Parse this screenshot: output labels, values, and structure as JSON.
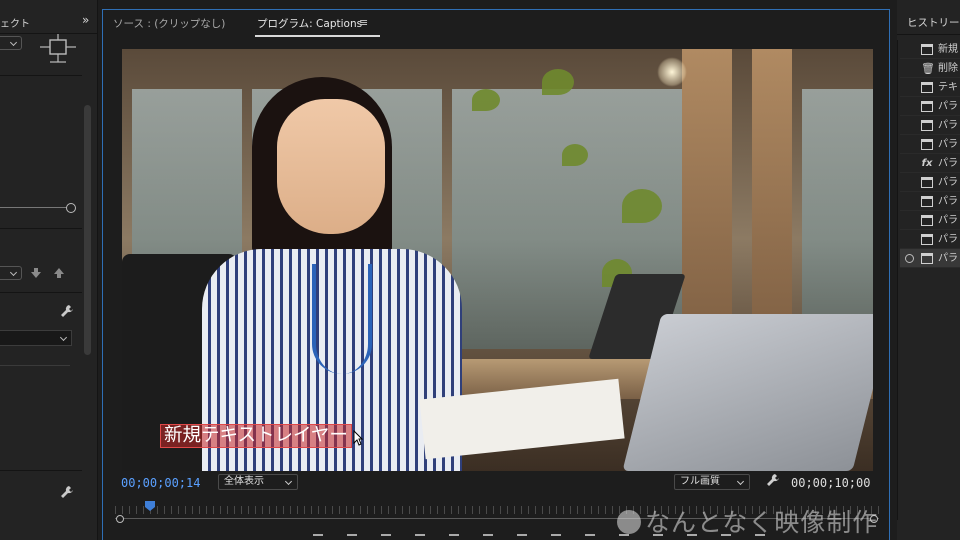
{
  "left_panel": {
    "tab_title": "ェクト",
    "expand_glyph": "»"
  },
  "monitor": {
    "source_tab": "ソース : (クリップなし)",
    "program_tab": "プログラム: Captions",
    "menu_glyph": "≡",
    "caption": "新規テキストレイヤー",
    "timecode_current": "00;00;00;14",
    "zoom": "全体表示",
    "quality": "フル画質",
    "timecode_duration": "00;00;10;00",
    "accent_color": "#2f6fb5",
    "timecode_color": "#5aa0ff",
    "caption_box_color": "#e04848"
  },
  "history": {
    "title": "ヒストリー",
    "items": [
      {
        "icon": "clip-icon",
        "label": "新規"
      },
      {
        "icon": "trash-icon",
        "label": "削除"
      },
      {
        "icon": "clip-icon",
        "label": "テキ"
      },
      {
        "icon": "clip-icon",
        "label": "パラ"
      },
      {
        "icon": "clip-icon",
        "label": "パラ"
      },
      {
        "icon": "clip-icon",
        "label": "パラ"
      },
      {
        "icon": "fx-icon",
        "label": "パラ"
      },
      {
        "icon": "clip-icon",
        "label": "パラ"
      },
      {
        "icon": "clip-icon",
        "label": "パラ"
      },
      {
        "icon": "clip-icon",
        "label": "パラ"
      },
      {
        "icon": "clip-icon",
        "label": "パラ"
      },
      {
        "icon": "clip-icon",
        "label": "パラ",
        "selected": true
      }
    ]
  },
  "watermark": {
    "text": "なんとなく映像制作"
  }
}
